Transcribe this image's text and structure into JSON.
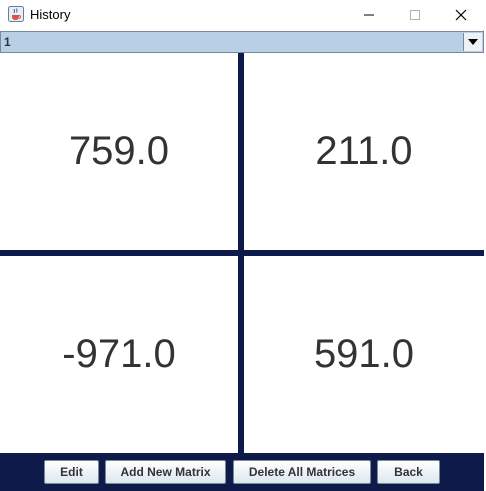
{
  "window": {
    "title": "History",
    "icon": "java-cup-icon"
  },
  "matrix_selector": {
    "selected": "1"
  },
  "matrix": {
    "cells": [
      [
        "759.0",
        "211.0"
      ],
      [
        "-971.0",
        "591.0"
      ]
    ]
  },
  "buttons": {
    "edit": "Edit",
    "add_new": "Add New Matrix",
    "delete_all": "Delete All Matrices",
    "back": "Back"
  },
  "colors": {
    "grid_background": "#0e1a4a",
    "combo_background": "#b8cfe5",
    "cell_text": "#333333"
  }
}
